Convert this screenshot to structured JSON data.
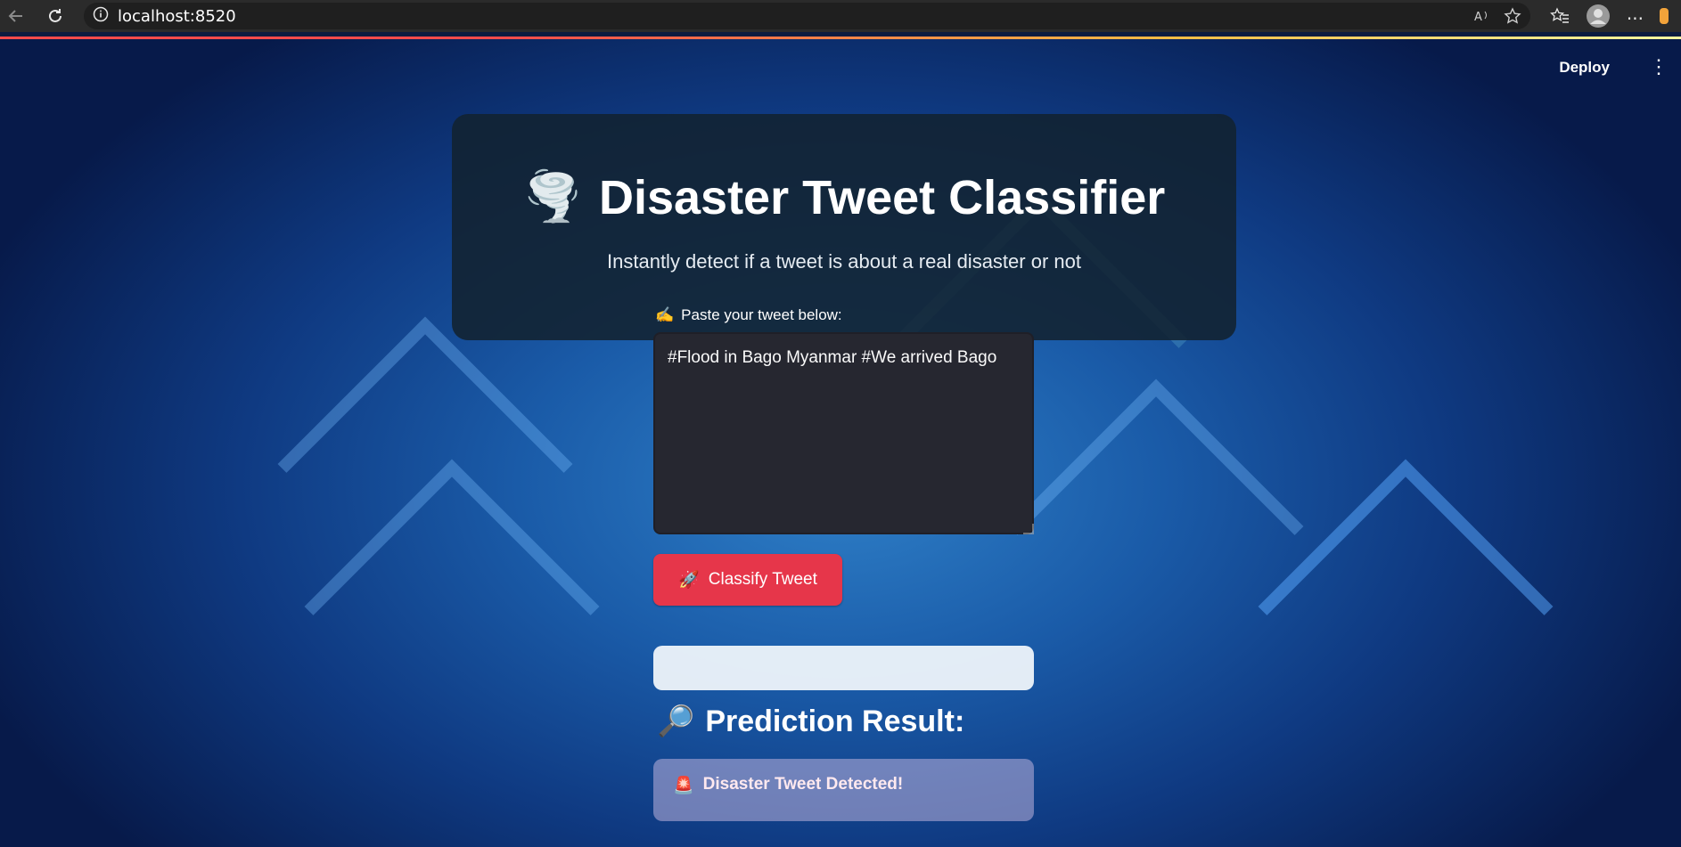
{
  "browser": {
    "url": "localhost:8520",
    "icons": [
      "back-icon",
      "reload-icon",
      "info-icon",
      "read-aloud-icon",
      "favorite-star-icon",
      "favorites-icon",
      "profile-icon",
      "more-icon"
    ]
  },
  "header": {
    "deploy_label": "Deploy",
    "menu_label": "⋮"
  },
  "hero": {
    "emoji": "🌪️",
    "title": "Disaster Tweet Classifier",
    "subtitle": "Instantly detect if a tweet is about a real disaster or not"
  },
  "input": {
    "emoji": "✍️",
    "label": "Paste your tweet below:",
    "value": "#Flood in Bago Myanmar #We arrived Bago"
  },
  "classify_button": {
    "emoji": "🚀",
    "label": "Classify Tweet"
  },
  "result": {
    "emoji": "🔎",
    "title": "Prediction Result:",
    "alert_emoji": "🚨",
    "alert_text": "Disaster Tweet Detected!"
  },
  "colors": {
    "accent": "#e6364a",
    "panel": "#122230",
    "textarea": "#262730"
  }
}
